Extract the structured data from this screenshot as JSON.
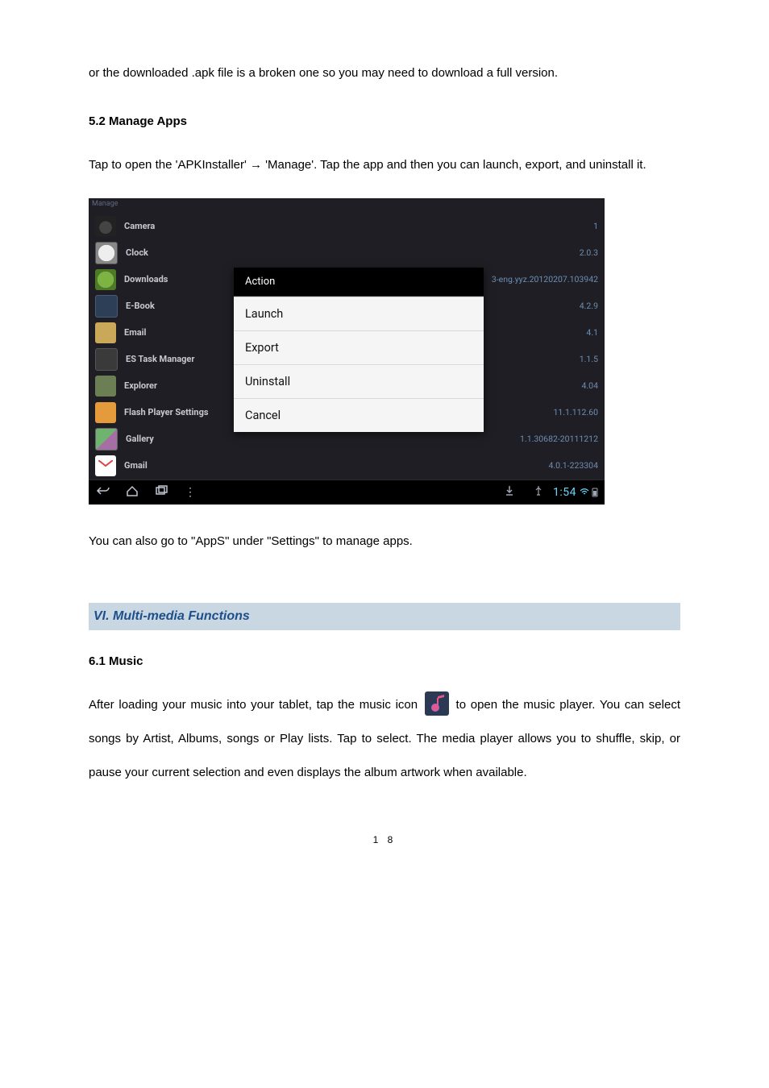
{
  "para1": "or the downloaded .apk file is a broken one so you may need to download a full version.",
  "sec52": "5.2 Manage Apps",
  "para2": "Tap to open the 'APKInstaller' → 'Manage'. Tap the app and then you can launch, export, and uninstall it.",
  "screenshot": {
    "top_label": "Manage",
    "apps": [
      {
        "name": "Camera",
        "ver": "1"
      },
      {
        "name": "Clock",
        "ver": "2.0.3"
      },
      {
        "name": "Downloads",
        "ver": "3-eng.yyz.20120207.103942"
      },
      {
        "name": "E-Book",
        "ver": "4.2.9"
      },
      {
        "name": "Email",
        "ver": "4.1"
      },
      {
        "name": "ES Task Manager",
        "ver": "1.1.5"
      },
      {
        "name": "Explorer",
        "ver": "4.04"
      },
      {
        "name": "Flash Player Settings",
        "ver": "11.1.112.60"
      },
      {
        "name": "Gallery",
        "ver": "1.1.30682-20111212"
      },
      {
        "name": "Gmail",
        "ver": "4.0.1-223304"
      }
    ],
    "menu": {
      "title": "Action",
      "items": [
        "Launch",
        "Export",
        "Uninstall",
        "Cancel"
      ]
    },
    "clock": "1:54"
  },
  "para3": "You can also go to \"AppS\" under \"Settings\" to manage apps.",
  "banner6": "VI. Multi-media Functions",
  "sec61": "6.1 Music",
  "para4a": "After loading your music into your tablet, tap the music icon ",
  "para4b": " to open the music player. You can select songs by Artist, Albums, songs or Play lists. Tap to select. The media player allows you to shuffle, skip, or pause your current selection and even displays the album artwork when available.",
  "page_num": "1 8"
}
